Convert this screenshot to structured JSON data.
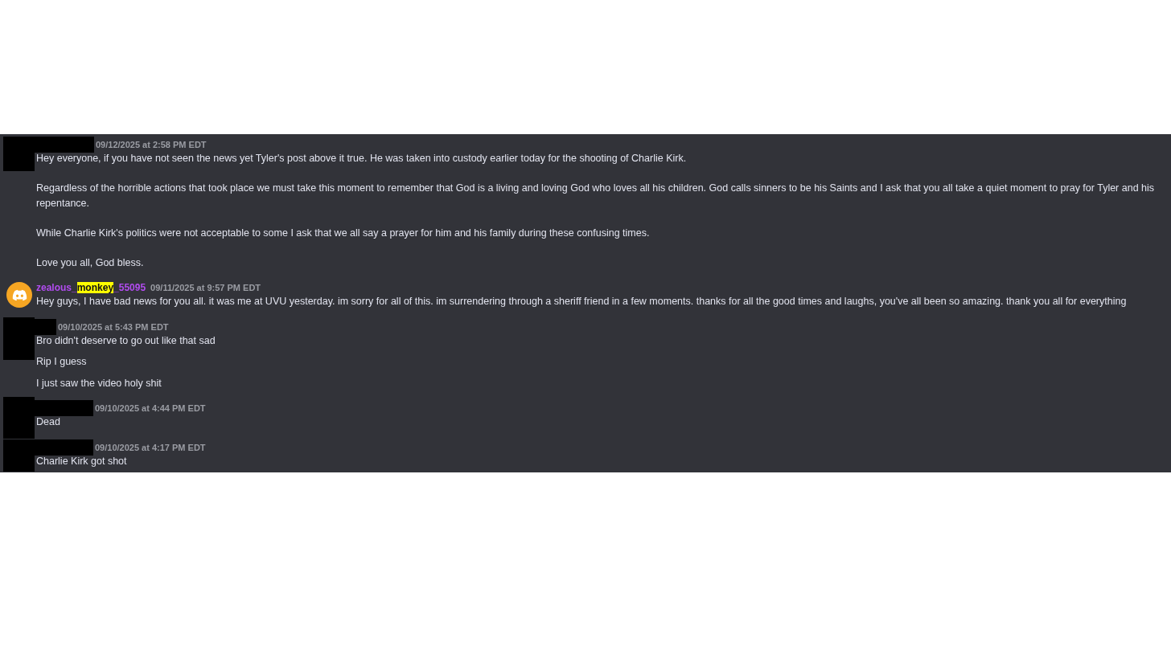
{
  "messages": [
    {
      "author": {
        "kind": "redacted"
      },
      "timestamp": "09/12/2025 at 2:58 PM EDT",
      "entries": [
        {
          "paragraphs": [
            "Hey everyone, if you have not seen the news yet Tyler's post above it true. He was taken into custody earlier today for the shooting of Charlie Kirk.",
            "Regardless of the horrible actions that took place we must take this moment to remember that God is a living and loving God who loves all his children. God calls sinners to be his Saints and I ask that you all take a quiet moment to pray for Tyler and his repentance.",
            "While Charlie Kirk's politics were not acceptable to some I ask that we all say a prayer for him and his family during these confusing times.",
            "Love you all, God bless."
          ]
        }
      ]
    },
    {
      "author": {
        "kind": "user",
        "name_parts": [
          {
            "text": "zealous_",
            "highlighted": false
          },
          {
            "text": "monkey",
            "highlighted": true
          },
          {
            "text": "_55095",
            "highlighted": false
          }
        ]
      },
      "timestamp": "09/11/2025 at 9:57 PM EDT",
      "entries": [
        {
          "paragraphs": [
            "Hey guys, I have bad news for you all. it was me at UVU yesterday. im sorry for all of this. im surrendering through a sheriff friend in a few moments. thanks for all the good times and laughs, you've all been so amazing. thank you all for everything"
          ]
        }
      ]
    },
    {
      "author": {
        "kind": "redacted"
      },
      "timestamp": "09/10/2025 at 5:43 PM EDT",
      "entries": [
        {
          "paragraphs": [
            "Bro didn't deserve to go out like that sad"
          ]
        },
        {
          "paragraphs": [
            "Rip I guess"
          ]
        },
        {
          "paragraphs": [
            "I just saw the video holy shit"
          ]
        }
      ]
    },
    {
      "author": {
        "kind": "redacted"
      },
      "timestamp": "09/10/2025 at 4:44 PM EDT",
      "entries": [
        {
          "paragraphs": [
            "Dead"
          ]
        }
      ]
    },
    {
      "author": {
        "kind": "redacted"
      },
      "timestamp": "09/10/2025 at 4:17 PM EDT",
      "entries": [
        {
          "paragraphs": [
            "Charlie Kirk got shot"
          ]
        }
      ]
    }
  ]
}
